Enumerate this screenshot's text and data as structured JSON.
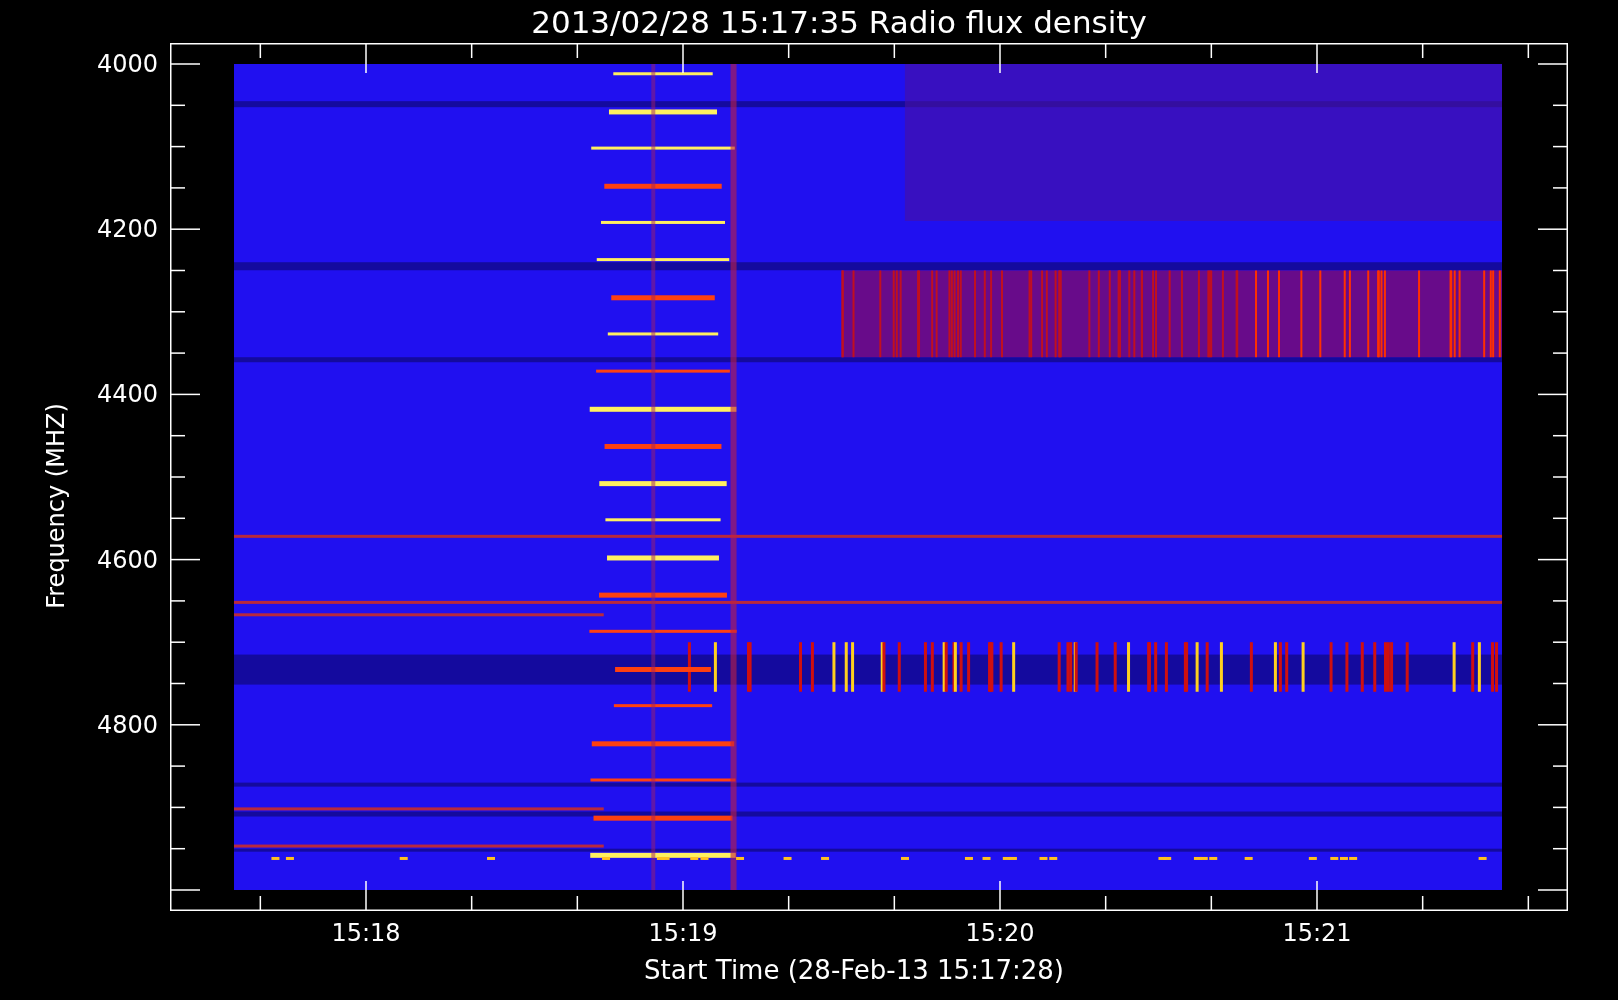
{
  "title": "2013/02/28 15:17:35 Radio flux density",
  "y_axis": {
    "label": "Frequency (MHZ)",
    "ticks": [
      "4000",
      "4200",
      "4400",
      "4600",
      "4800"
    ]
  },
  "x_axis": {
    "label": "Start Time (28-Feb-13 15:17:28)",
    "ticks": [
      "15:18",
      "15:19",
      "15:20",
      "15:21"
    ]
  }
}
